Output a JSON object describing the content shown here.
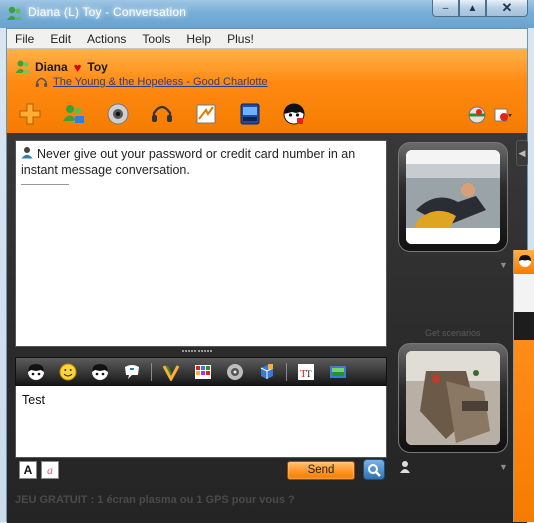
{
  "window": {
    "title": "Diana (L) Toy - Conversation",
    "minimize_glyph": "‒",
    "maximize_glyph": "▲",
    "close_glyph": "✕"
  },
  "menu": {
    "items": [
      "File",
      "Edit",
      "Actions",
      "Tools",
      "Help",
      "Plus!"
    ]
  },
  "contact": {
    "name_first": "Diana",
    "name_second": "Toy",
    "now_playing": "The Young & the Hopeless - Good Charlotte"
  },
  "toolbar": {
    "icons": [
      "invite-icon",
      "share-files-icon",
      "webcam-icon",
      "audio-headset-icon",
      "activities-icon",
      "games-icon",
      "block-icon"
    ],
    "right_icons": [
      "display-picture-icon",
      "options-menu-icon"
    ]
  },
  "history": {
    "safety_notice": "Never give out your password or credit card number in an instant message conversation."
  },
  "format_toolbar": {
    "icons": [
      "wink-icon",
      "emoticon-icon",
      "winks-icon",
      "nudge-icon",
      "voice-clip-icon",
      "backgrounds-icon",
      "handwriting-icon",
      "send-file-icon",
      "font-icon",
      "background-color-icon"
    ]
  },
  "compose": {
    "text": "Test",
    "font_label": "A",
    "ink_label": "a",
    "send_label": "Send"
  },
  "side": {
    "caption": "Get scenarios"
  },
  "advert": {
    "text": "JEU GRATUIT : 1 écran plasma ou 1 GPS pour vous ?"
  },
  "colors": {
    "accent": "#f57c00",
    "panel": "#2a2a2a",
    "link": "#2c3e88"
  }
}
